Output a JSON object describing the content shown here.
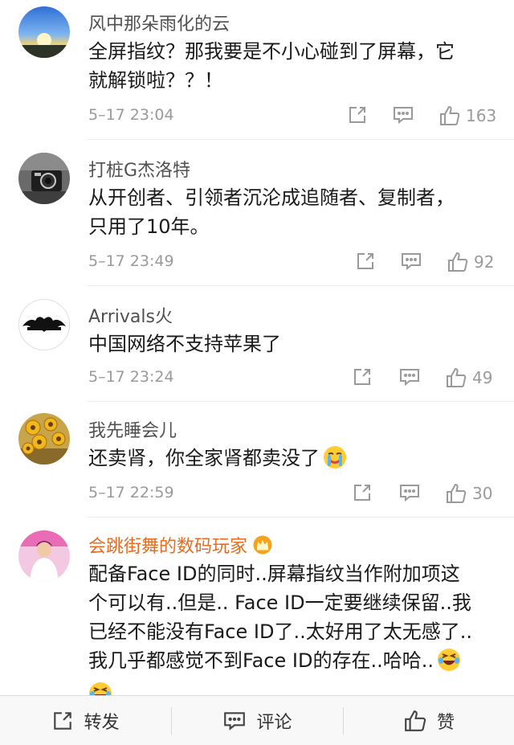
{
  "comments": [
    {
      "username": "风中那朵雨化的云",
      "lines": [
        "全屏指纹？那我要是不小心碰到了屏幕，它",
        "就解锁啦？？！"
      ],
      "time": "5–17 23:04",
      "likes": "163",
      "avatar": "sunset-sky-avatar"
    },
    {
      "username": "打桩G杰洛特",
      "lines": [
        "从开创者、引领者沉沦成追随者、复制者，",
        "只用了10年。"
      ],
      "time": "5–17 23:49",
      "likes": "92",
      "avatar": "camera-avatar"
    },
    {
      "username": "Arrivals火",
      "lines": [
        "中国网络不支持苹果了"
      ],
      "time": "5–17 23:24",
      "likes": "49",
      "avatar": "batman-logo-avatar"
    },
    {
      "username": "我先睡会儿",
      "lines": [
        "还卖肾，你全家肾都卖没了"
      ],
      "time": "5–17 22:59",
      "likes": "30",
      "avatar": "sunflowers-avatar",
      "emoji": "crying-face-emoji"
    },
    {
      "username": "会跳街舞的数码玩家",
      "vip": true,
      "lines": [
        "配备Face ID的同时..屏幕指纹当作附加项这",
        "个可以有..但是.. Face ID一定要继续保留..我",
        "已经不能没有Face ID了..太好用了太无感了..",
        "我几乎都感觉不到Face ID的存在..哈哈.."
      ],
      "avatar": "person-in-white-avatar",
      "emoji": "laughing-tears-emoji"
    }
  ],
  "bottom_bar": {
    "repost_label": "转发",
    "comment_label": "评论",
    "like_label": "赞"
  },
  "colors": {
    "vip_name": "#e86b1e",
    "meta_gray": "#9a9a9a",
    "bar_bg": "#f8f8f8"
  }
}
